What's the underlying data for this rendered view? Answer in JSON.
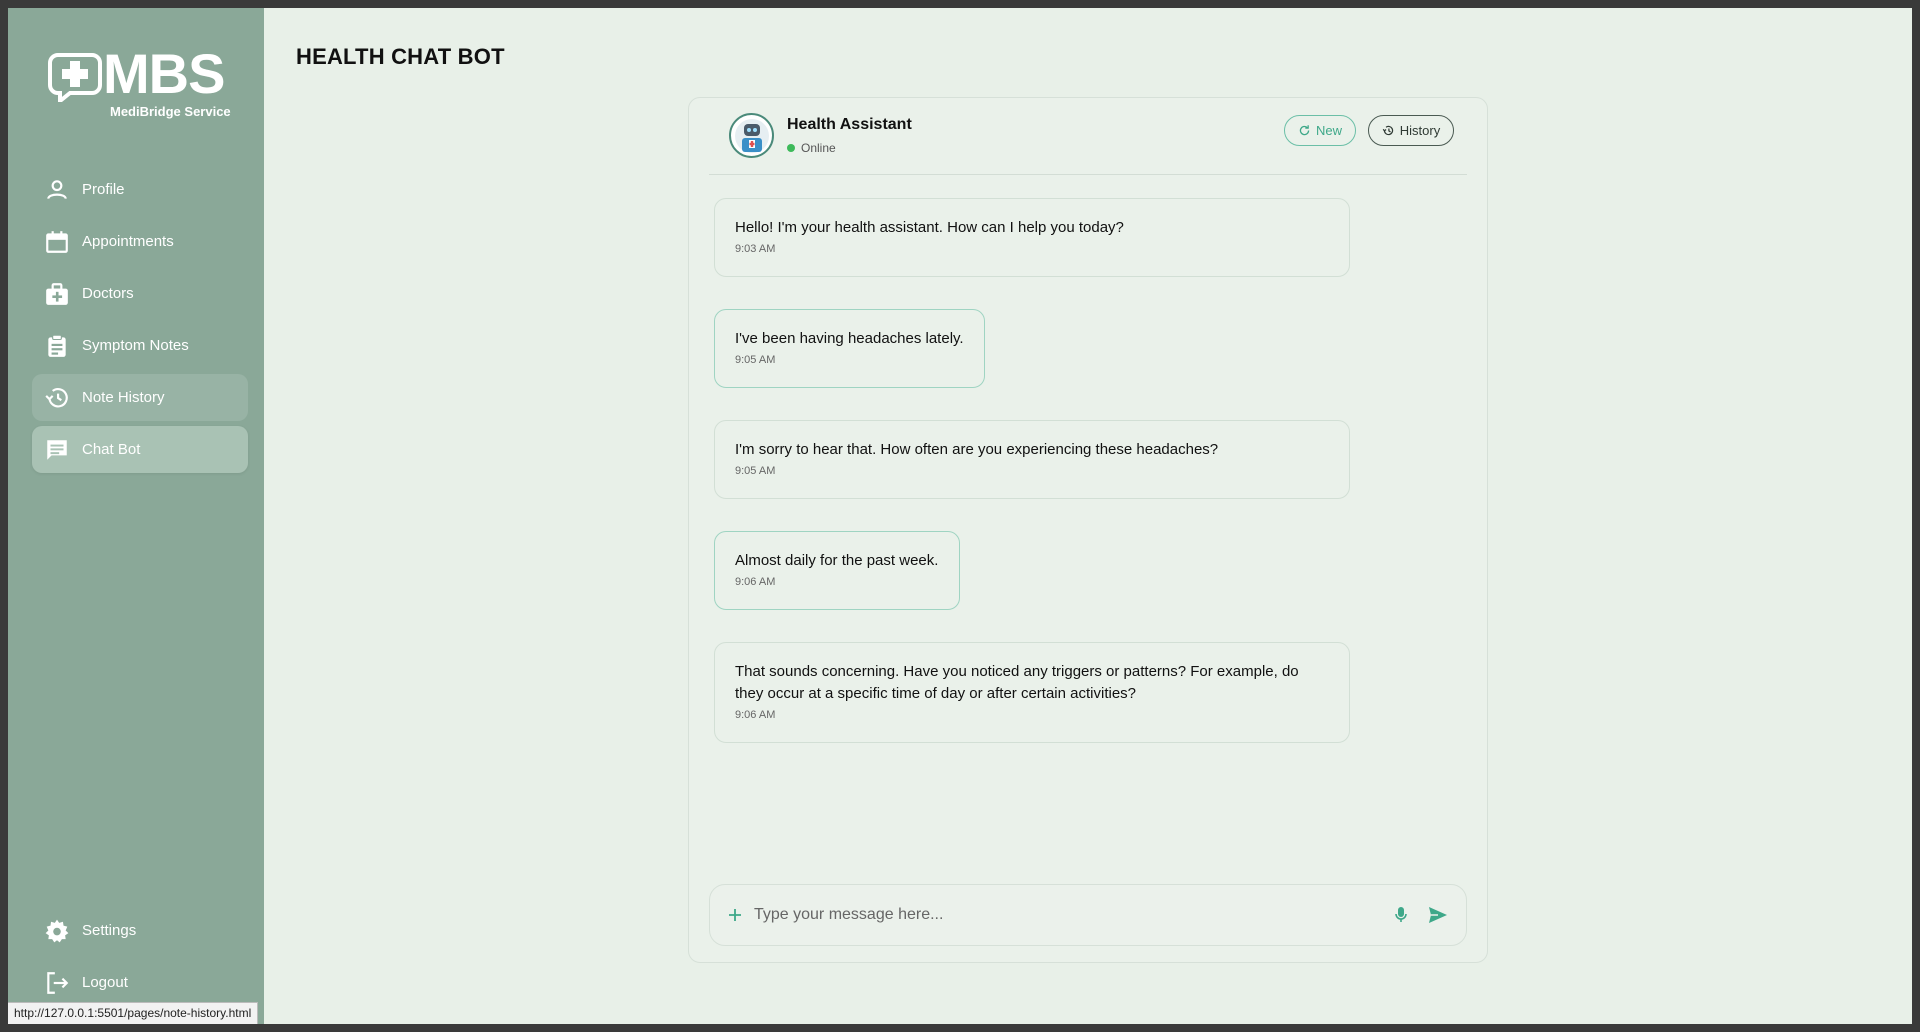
{
  "logo": {
    "text": "MBS",
    "subtitle": "MediBridge Service"
  },
  "sidebar": {
    "items": [
      {
        "label": "Profile",
        "icon": "person-icon"
      },
      {
        "label": "Appointments",
        "icon": "calendar-icon"
      },
      {
        "label": "Doctors",
        "icon": "medical-bag-icon"
      },
      {
        "label": "Symptom Notes",
        "icon": "clipboard-icon"
      },
      {
        "label": "Note History",
        "icon": "history-icon"
      },
      {
        "label": "Chat Bot",
        "icon": "chat-icon"
      }
    ],
    "bottom": [
      {
        "label": "Settings",
        "icon": "gear-icon"
      },
      {
        "label": "Logout",
        "icon": "logout-icon"
      }
    ]
  },
  "status_url": "http://127.0.0.1:5501/pages/note-history.html",
  "page": {
    "title": "HEALTH CHAT BOT"
  },
  "chat": {
    "assistant_name": "Health Assistant",
    "status": "Online",
    "new_label": "New",
    "history_label": "History",
    "messages": [
      {
        "from": "bot",
        "text": "Hello! I'm your health assistant. How can I help you today?",
        "time": "9:03 AM"
      },
      {
        "from": "user",
        "text": "I've been having headaches lately.",
        "time": "9:05 AM"
      },
      {
        "from": "bot",
        "text": "I'm sorry to hear that. How often are you experiencing these headaches?",
        "time": "9:05 AM"
      },
      {
        "from": "user",
        "text": "Almost daily for the past week.",
        "time": "9:06 AM"
      },
      {
        "from": "bot",
        "text": "That sounds concerning. Have you noticed any triggers or patterns? For example, do they occur at a specific time of day or after certain activities?",
        "time": "9:06 AM"
      }
    ],
    "input_placeholder": "Type your message here..."
  },
  "colors": {
    "sidebar": "#8aa898",
    "background": "#e8f0e8",
    "accent": "#3ea889"
  }
}
